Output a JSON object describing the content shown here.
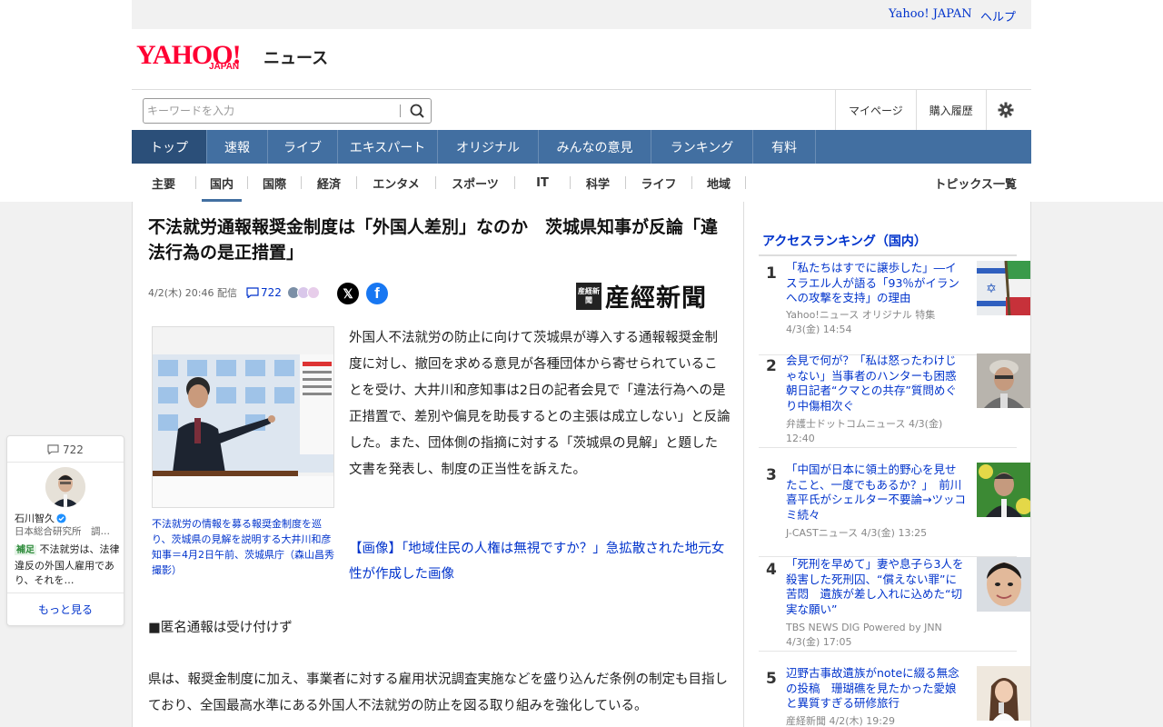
{
  "util": {
    "yahoo_japan": "Yahoo! JAPAN",
    "help": "ヘルプ"
  },
  "logo": {
    "brand": "YAHOO!",
    "sub": "JAPAN",
    "service": "ニュース"
  },
  "search": {
    "placeholder": "キーワードを入力"
  },
  "toplinks": {
    "mypage": "マイページ",
    "history": "購入履歴"
  },
  "mainnav": [
    "トップ",
    "速報",
    "ライブ",
    "エキスパート",
    "オリジナル",
    "みんなの意見",
    "ランキング",
    "有料"
  ],
  "subnav": [
    "主要",
    "国内",
    "国際",
    "経済",
    "エンタメ",
    "スポーツ",
    "IT",
    "科学",
    "ライフ",
    "地域"
  ],
  "topics_all": "トピックス一覧",
  "article": {
    "title": "不法就労通報報奨金制度は「外国人差別」なのか　茨城県知事が反論「違法行為の是正措置」",
    "date": "4/2(木) 20:46 配信",
    "comment_count": "722",
    "publisher_seal": "産経新聞",
    "publisher": "産經新聞",
    "caption": "不法就労の情報を募る報奨金制度を巡り、茨城県の見解を説明する大井川和彦知事＝4月2日午前、茨城県庁（森山昌秀撮影）",
    "body1": "外国人不法就労の防止に向けて茨城県が導入する通報報奨金制度に対し、撤回を求める意見が各種団体から寄せられていることを受け、大井川和彦知事は2日の記者会見で「違法行為への是正措置で、差別や偏見を助長するとの主張は成立しない」と反論した。また、団体側の指摘に対する「茨城県の見解」と題した文書を発表し、制度の正当性を訴えた。",
    "image_link": "【画像】「地域住民の人権は無視ですか？」急拡散された地元女性が作成した画像",
    "section": "■匿名通報は受け付けず",
    "body2": "県は、報奨金制度に加え、事業者に対する雇用状況調査実施などを盛り込んだ条例の制定も目指しており、全国最高水準にある外国人不法就労の防止を図る取り組みを強化している。"
  },
  "ranking": {
    "title": "アクセスランキング（国内）",
    "items": [
      {
        "rank": "1",
        "title": "「私たちはすでに譲歩した」―イスラエル人が語る「93％がイランへの攻撃を支持」の理由",
        "source": "Yahoo!ニュース オリジナル 特集",
        "time": "4/3(金) 14:54"
      },
      {
        "rank": "2",
        "title": "会見で何が？「私は怒ったわけじゃない」当事者のハンターも困惑 朝日記者“クマとの共存”質問めぐり中傷相次ぐ",
        "source": "弁護士ドットコムニュース 4/3(金)",
        "time": "12:40"
      },
      {
        "rank": "3",
        "title": "「中国が日本に領土的野心を見せたこと、一度でもあるか？」　前川喜平氏がシェルター不要論→ツッコミ続々",
        "source": "J-CASTニュース 4/3(金) 13:25",
        "time": ""
      },
      {
        "rank": "4",
        "title": "「死刑を早めて」妻や息子ら3人を殺害した死刑囚、“償えない罪”に苦悶　遺族が差し入れに込めた“切実な願い”",
        "source": "TBS NEWS DIG Powered by JNN",
        "time": "4/3(金) 17:05"
      },
      {
        "rank": "5",
        "title": "辺野古事故遺族がnoteに綴る無念の投稿　珊瑚礁を見たかった愛娘と異質すぎる研修旅行",
        "source": "産経新聞 4/2(木) 19:29",
        "time": ""
      }
    ]
  },
  "expert": {
    "comment_count": "722",
    "name": "石川智久",
    "org": "日本総合研究所　調…",
    "badge": "補足",
    "text": "不法就労は、法律違反の外国人雇用であり、それを…",
    "more": "もっと見る"
  },
  "colors": {
    "nav": "#426fa1",
    "link": "#0033cc",
    "brand": "#ff0033"
  }
}
